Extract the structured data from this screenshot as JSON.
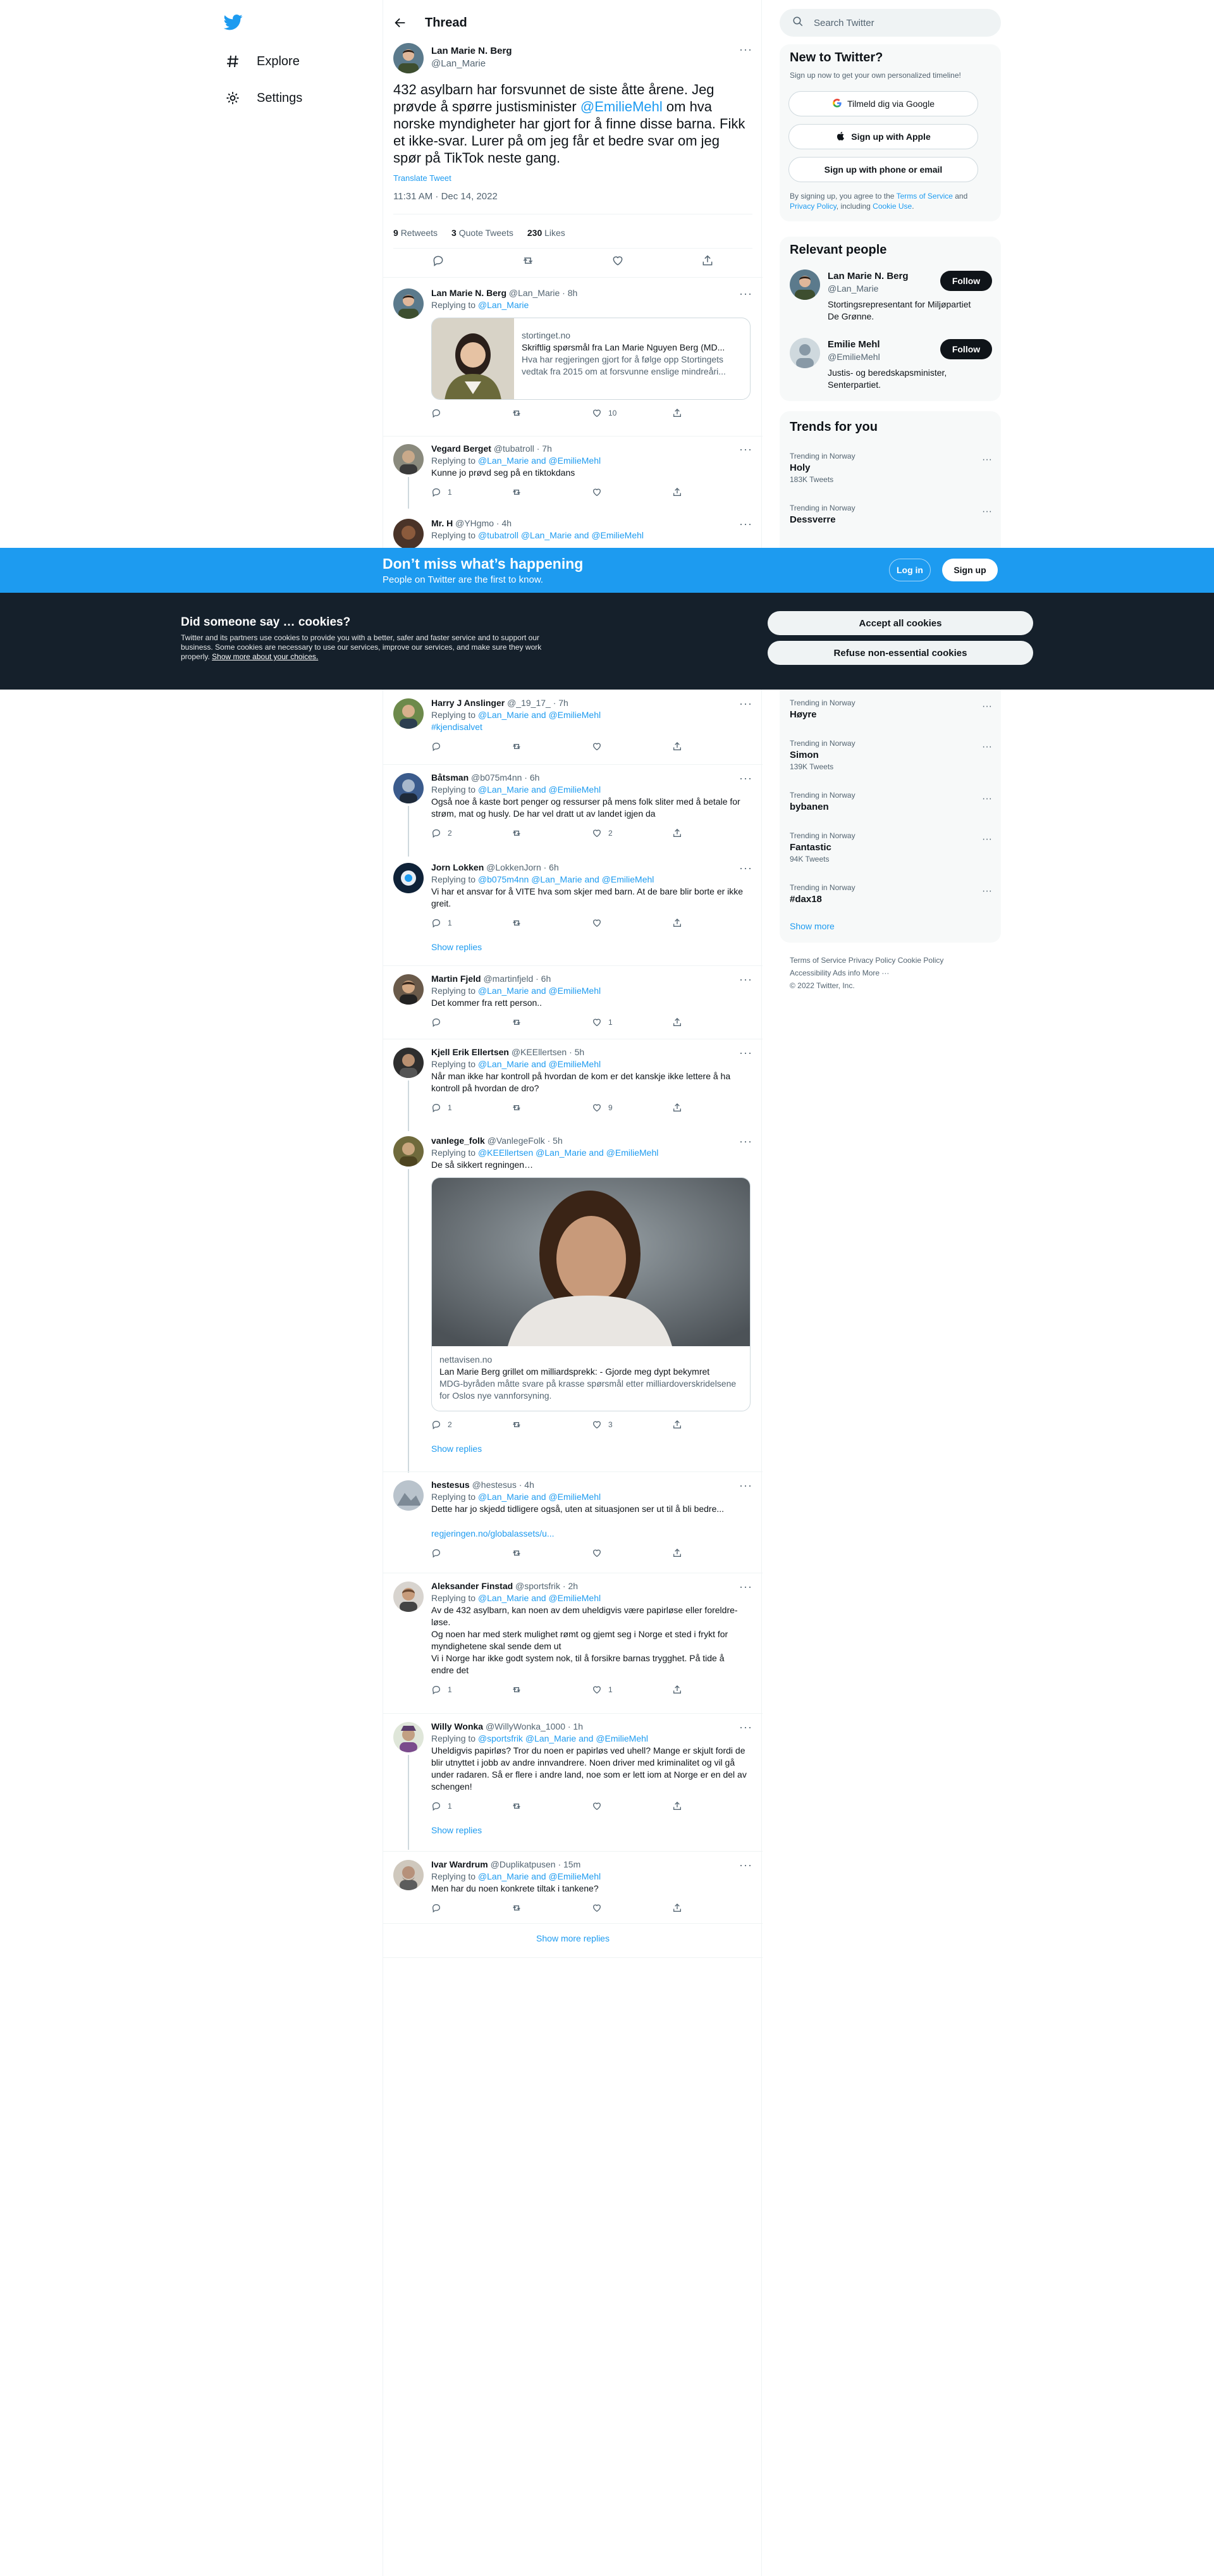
{
  "nav": {
    "explore": "Explore",
    "settings": "Settings"
  },
  "header": {
    "title": "Thread"
  },
  "focal": {
    "name": "Lan Marie N. Berg",
    "handle": "@Lan_Marie",
    "text_before": "432 asylbarn har forsvunnet de siste åtte årene. Jeg prøvde å spørre justisminister ",
    "mention": "@EmilieMehl",
    "text_after": " om hva norske myndigheter har gjort for å finne disse barna. Fikk et ikke-svar. Lurer på om jeg får et bedre svar om jeg spør på TikTok neste gang.",
    "translate": "Translate Tweet",
    "time": "11:31 AM · Dec 14, 2022",
    "retweets_n": "9",
    "retweets_l": "Retweets",
    "quotes_n": "3",
    "quotes_l": "Quote Tweets",
    "likes_n": "230",
    "likes_l": "Likes"
  },
  "replies": [
    {
      "name": "Lan Marie N. Berg",
      "handle": "@Lan_Marie · 8h",
      "replying": "Replying to ",
      "to": "@Lan_Marie",
      "card": {
        "domain": "stortinget.no",
        "title": "Skriftlig spørsmål fra Lan Marie Nguyen Berg (MD...",
        "desc": "Hva har regjeringen gjort for å følge opp Stortingets vedtak fra 2015 om at forsvunne enslige mindreåri..."
      },
      "reply": "",
      "rt": "",
      "like": "10"
    },
    {
      "name": "Vegard Berget",
      "handle": "@tubatroll · 7h",
      "replying": "Replying to ",
      "to": "@Lan_Marie and @EmilieMehl",
      "text": "Kunne jo prøvd seg på en tiktokdans",
      "reply": "1",
      "rt": "",
      "like": ""
    },
    {
      "name": "Mr. H",
      "handle": "@YHgmo · 4h",
      "replying": "Replying to ",
      "to": "@tubatroll @Lan_Marie and @EmilieMehl"
    },
    {
      "name": "Harry J Anslinger",
      "handle": "@_19_17_ · 7h",
      "replying": "Replying to ",
      "to": "@Lan_Marie and @EmilieMehl",
      "text": "#kjendisalvet",
      "reply": "",
      "rt": "",
      "like": ""
    },
    {
      "name": "Båtsman",
      "handle": "@b075m4nn · 6h",
      "replying": "Replying to ",
      "to": "@Lan_Marie and @EmilieMehl",
      "text": "Også noe å kaste bort penger og ressurser på mens folk sliter med å betale for strøm, mat og husly. De har vel dratt ut av landet igjen da",
      "reply": "2",
      "rt": "",
      "like": "2"
    },
    {
      "name": "Jorn Lokken",
      "handle": "@LokkenJorn · 6h",
      "replying": "Replying to ",
      "to": "@b075m4nn @Lan_Marie and @EmilieMehl",
      "text": "Vi har et ansvar for å VITE hva som skjer med barn. At de bare blir borte er ikke greit.",
      "reply": "1",
      "rt": "",
      "like": ""
    },
    {
      "name": "Martin Fjeld",
      "handle": "@martinfjeld · 6h",
      "replying": "Replying to ",
      "to": "@Lan_Marie and @EmilieMehl",
      "text": "Det kommer fra rett person..",
      "reply": "",
      "rt": "",
      "like": "1"
    },
    {
      "name": "Kjell Erik Ellertsen",
      "handle": "@KEEllertsen · 5h",
      "replying": "Replying to ",
      "to": "@Lan_Marie and @EmilieMehl",
      "text": "Når man ikke har kontroll på hvordan de kom er det kanskje ikke lettere å ha kontroll på hvordan de dro?",
      "reply": "1",
      "rt": "",
      "like": "9"
    },
    {
      "name": "vanlege_folk",
      "handle": "@VanlegeFolk · 5h",
      "replying": "Replying to ",
      "to": "@KEEllertsen @Lan_Marie and @EmilieMehl",
      "text": "De så sikkert regningen…",
      "card": {
        "domain": "nettavisen.no",
        "title": "Lan Marie Berg grillet om milliardsprekk: - Gjorde meg dypt bekymret",
        "desc": "MDG-byråden måtte svare på krasse spørsmål etter milliardoverskridelsene for Oslos nye vannforsyning."
      },
      "reply": "2",
      "rt": "",
      "like": "3"
    },
    {
      "name": "hestesus",
      "handle": "@hestesus · 4h",
      "replying": "Replying to ",
      "to": "@Lan_Marie and @EmilieMehl",
      "text": "Dette har jo skjedd tidligere også, uten at situasjonen ser ut til å bli bedre...",
      "link": "regjeringen.no/globalassets/u...",
      "reply": "",
      "rt": "",
      "like": ""
    },
    {
      "name": "Aleksander Finstad",
      "handle": "@sportsfrik · 2h",
      "replying": "Replying to ",
      "to": "@Lan_Marie and @EmilieMehl",
      "text1": "Av de 432 asylbarn, kan noen av dem uheldigvis være papirløse eller foreldre-løse.",
      "text2": "Og noen har med sterk mulighet rømt og gjemt seg i Norge et sted i frykt for myndighetene skal sende dem ut",
      "text3": "Vi i Norge har ikke godt system nok, til å forsikre barnas trygghet. På tide å endre det",
      "reply": "1",
      "rt": "",
      "like": "1"
    },
    {
      "name": "Willy Wonka",
      "handle": "@WillyWonka_1000 · 1h",
      "replying": "Replying to ",
      "to": "@sportsfrik @Lan_Marie and @EmilieMehl",
      "text": "Uheldigvis papirløs? Tror du noen er papirløs ved uhell? Mange er skjult fordi de blir utnyttet i jobb av andre innvandrere. Noen driver med kriminalitet og vil gå under radaren. Så er flere i andre land, noe som er lett iom at Norge er en del av schengen!",
      "reply": "1",
      "rt": "",
      "like": ""
    },
    {
      "name": "Ivar Wardrum",
      "handle": "@Duplikatpusen · 15m",
      "replying": "Replying to ",
      "to": "@Lan_Marie and @EmilieMehl",
      "text": "Men har du noen konkrete tiltak i tankene?",
      "reply": "",
      "rt": "",
      "like": ""
    }
  ],
  "show_replies": "Show replies",
  "show_more_replies": "Show more replies",
  "right": {
    "search_placeholder": "Search Twitter",
    "new_title": "New to Twitter?",
    "new_sub": "Sign up now to get your own personalized timeline!",
    "google": "Tilmeld dig via Google",
    "apple": "Sign up with Apple",
    "phone": "Sign up with phone or email",
    "terms_a": "By signing up, you agree to the ",
    "terms_b": "Terms of Service",
    "terms_c": " and ",
    "terms_d": "Privacy Policy",
    "terms_e": ", including ",
    "terms_f": "Cookie Use",
    "terms_g": ".",
    "relevant_title": "Relevant people",
    "people": [
      {
        "name": "Lan Marie N. Berg",
        "handle": "@Lan_Marie",
        "bio": "Stortingsrepresentant for Miljøpartiet De Grønne.",
        "btn": "Follow"
      },
      {
        "name": "Emilie Mehl",
        "handle": "@EmilieMehl",
        "bio": "Justis- og beredskapsminister, Senterpartiet.",
        "btn": "Follow"
      }
    ],
    "trends_title": "Trends for you",
    "trends": [
      {
        "ctx": "Trending in Norway",
        "name": "Holy",
        "count": "183K Tweets"
      },
      {
        "ctx": "Trending in Norway",
        "name": "Dessverre",
        "count": ""
      },
      {
        "ctx": "Trending in Norway",
        "name": "Høyre",
        "count": ""
      },
      {
        "ctx": "Trending in Norway",
        "name": "Simon",
        "count": "139K Tweets"
      },
      {
        "ctx": "Trending in Norway",
        "name": "bybanen",
        "count": ""
      },
      {
        "ctx": "Trending in Norway",
        "name": "Fantastic",
        "count": "94K Tweets"
      },
      {
        "ctx": "Trending in Norway",
        "name": "#dax18",
        "count": ""
      }
    ],
    "show_more": "Show more",
    "footer1": "Terms of Service   Privacy Policy   Cookie Policy",
    "footer2": "Accessibility   Ads info   More ···",
    "footer3": "© 2022 Twitter, Inc."
  },
  "banner": {
    "title": "Don’t miss what’s happening",
    "sub": "People on Twitter are the first to know.",
    "login": "Log in",
    "signup": "Sign up"
  },
  "cookie": {
    "title": "Did someone say … cookies?",
    "text": "Twitter and its partners use cookies to provide you with a better, safer and faster service and to support our business. Some cookies are necessary to use our services, improve our services, and make sure they work properly. ",
    "link": "Show more about your choices.",
    "accept": "Accept all cookies",
    "refuse": "Refuse non-essential cookies"
  }
}
